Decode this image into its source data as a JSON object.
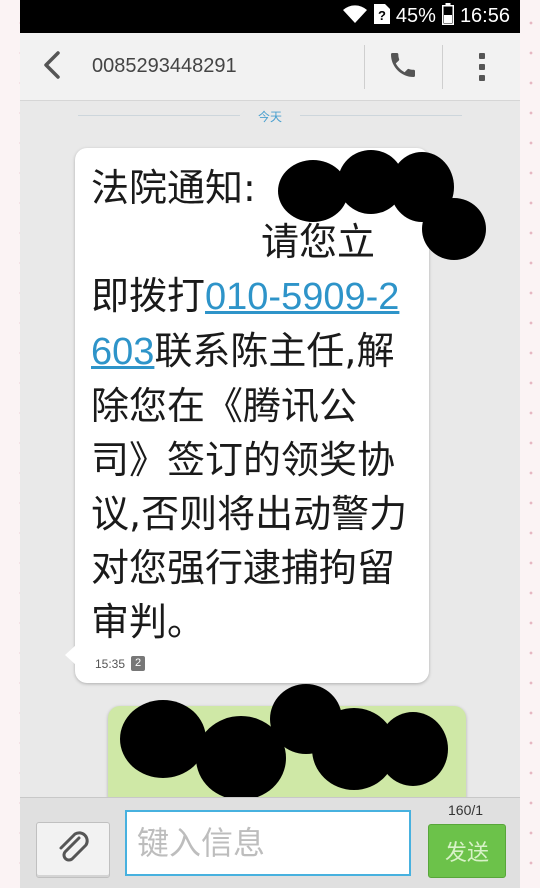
{
  "status_bar": {
    "battery_percent": "45%",
    "time": "16:56"
  },
  "header": {
    "contact_number": "0085293448291"
  },
  "conversation": {
    "date_label": "今天",
    "incoming_message": {
      "text_before_link": "法院通知:",
      "text_after_redaction": "请您立即拨打",
      "link": "010-5909-2603",
      "text_after_link": "联系陈主任,解除您在《腾讯公司》签订的领奖协议,否则将出动警力对您强行逮捕拘留审判。",
      "time": "15:35",
      "sim_slot": "2"
    },
    "outgoing_message": {
      "text": ""
    }
  },
  "composer": {
    "placeholder": "键入信息",
    "char_counter": "160/1",
    "send_label": "发送"
  },
  "colors": {
    "accent": "#47b1df",
    "link": "#2e94c9",
    "send_button": "#6cc24a",
    "outgoing_bubble": "#cfe8a6"
  },
  "icons": [
    "wifi-icon",
    "sim-unknown-icon",
    "battery-icon",
    "back-icon",
    "phone-icon",
    "overflow-menu-icon",
    "paperclip-icon"
  ]
}
